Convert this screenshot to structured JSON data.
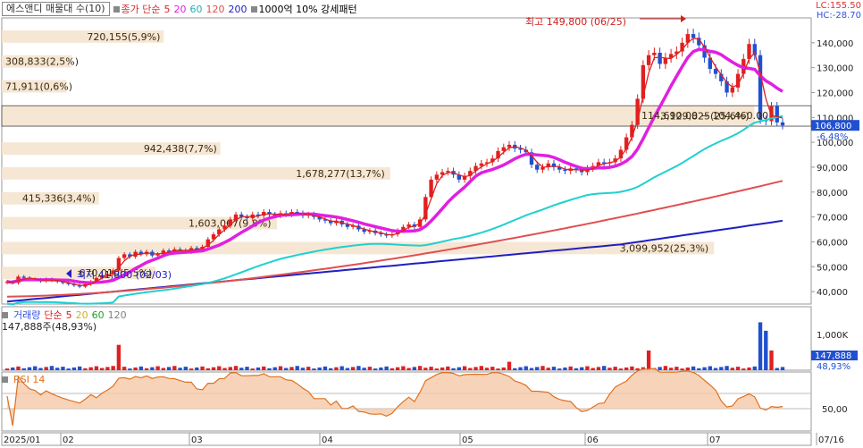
{
  "header": {
    "symbol_label": "에스앤디 매물대 수(10)",
    "ma_legend_prefix": "종가 단순",
    "ma_periods": [
      "5",
      "20",
      "60",
      "120",
      "200"
    ],
    "ma_colors": [
      "#e02020",
      "#e020e0",
      "#20d0d0",
      "#e05050",
      "#2020c0"
    ],
    "pattern_label": "1000억 10% 강세패턴",
    "lc_label": "LC:155.50",
    "hc_label": "HC:-28.70"
  },
  "annotations": {
    "high": "최고 149,800 (06/25)",
    "low": "최저 41,800 (02/03)",
    "range_text": "114,690.00 ~ 104,460.00",
    "current_price": "106,800",
    "current_change": "-6.48%"
  },
  "chart_data": {
    "type": "candlestick",
    "y_axis_ticks": [
      "140,000",
      "130,000",
      "120,000",
      "110,000",
      "100,000",
      "90,000",
      "80,000",
      "70,000",
      "60,000",
      "50,000",
      "40,000"
    ],
    "ylim": [
      35000,
      150000
    ],
    "x_axis_labels": [
      "2025/01",
      "02",
      "03",
      "04",
      "05",
      "06",
      "07",
      "07/16"
    ],
    "volume_profile": [
      {
        "label": "720,155(5,9%)",
        "price_low": 140000,
        "price_high": 145000,
        "fraction": 0.2
      },
      {
        "label": "308,833(2,5%)",
        "price_low": 130000,
        "price_high": 135000,
        "fraction": 0.086
      },
      {
        "label": "71,911(0,6%)",
        "price_low": 120000,
        "price_high": 125000,
        "fraction": 0.08
      },
      {
        "label": "3,129,825(25,6%)",
        "price_low": 106500,
        "price_high": 114700,
        "fraction": 0.93
      },
      {
        "label": "942,438(7,7%)",
        "price_low": 95000,
        "price_high": 100000,
        "fraction": 0.27
      },
      {
        "label": "1,678,277(13,7%)",
        "price_low": 85000,
        "price_high": 90000,
        "fraction": 0.48
      },
      {
        "label": "415,336(3,4%)",
        "price_low": 75000,
        "price_high": 80000,
        "fraction": 0.12
      },
      {
        "label": "1,603,067(9,8%)",
        "price_low": 65000,
        "price_high": 70000,
        "fraction": 0.34
      },
      {
        "label": "3,099,952(25,3%)",
        "price_low": 55000,
        "price_high": 60000,
        "fraction": 0.88
      },
      {
        "label": "670,010(5,5%)",
        "price_low": 45000,
        "price_high": 50000,
        "fraction": 0.19
      }
    ],
    "candles_close": [
      44000,
      43500,
      46000,
      45500,
      45000,
      44800,
      44200,
      45000,
      44500,
      44000,
      43500,
      43000,
      42500,
      42000,
      43000,
      44000,
      45500,
      46500,
      47000,
      48500,
      53500,
      55000,
      54000,
      56000,
      55000,
      56000,
      54500,
      55000,
      56500,
      56000,
      57000,
      56500,
      56000,
      57500,
      57000,
      58000,
      61000,
      63000,
      65000,
      66500,
      69000,
      71000,
      70000,
      69500,
      71000,
      70500,
      72000,
      71000,
      70500,
      71500,
      71000,
      72000,
      71500,
      70500,
      71000,
      70000,
      69000,
      68500,
      67500,
      68500,
      67000,
      66000,
      66500,
      65000,
      64000,
      64500,
      63500,
      63000,
      62500,
      63000,
      64500,
      66000,
      67000,
      66000,
      69000,
      78000,
      85000,
      87000,
      88000,
      88500,
      87000,
      85000,
      86500,
      88500,
      90500,
      91500,
      92000,
      93500,
      96500,
      98000,
      99000,
      97500,
      97000,
      96000,
      91000,
      89000,
      90000,
      91500,
      90000,
      89000,
      88500,
      89500,
      89000,
      88000,
      89500,
      90500,
      92000,
      91500,
      92000,
      93500,
      97000,
      102000,
      107000,
      117500,
      131000,
      135000,
      136000,
      131500,
      134000,
      135500,
      136500,
      140000,
      143500,
      142000,
      139000,
      134000,
      129500,
      127500,
      124500,
      120000,
      122000,
      127500,
      133500,
      139500,
      135000,
      109000,
      108500,
      114500,
      108000,
      106800
    ],
    "volume_panel": {
      "legend_label": "거래량",
      "ma_prefix": "단순",
      "ma_periods": [
        "5",
        "20",
        "60",
        "120"
      ],
      "ma_colors": [
        "#e02020",
        "#e0c020",
        "#20a020",
        "#808080"
      ],
      "current_text": "147,888주(48,93%)",
      "axis_label": "1,000K",
      "current_value": "147,888",
      "current_pct": "48,93%"
    },
    "rsi_panel": {
      "legend_label": "RSI 14",
      "axis_label": "50,00"
    }
  }
}
